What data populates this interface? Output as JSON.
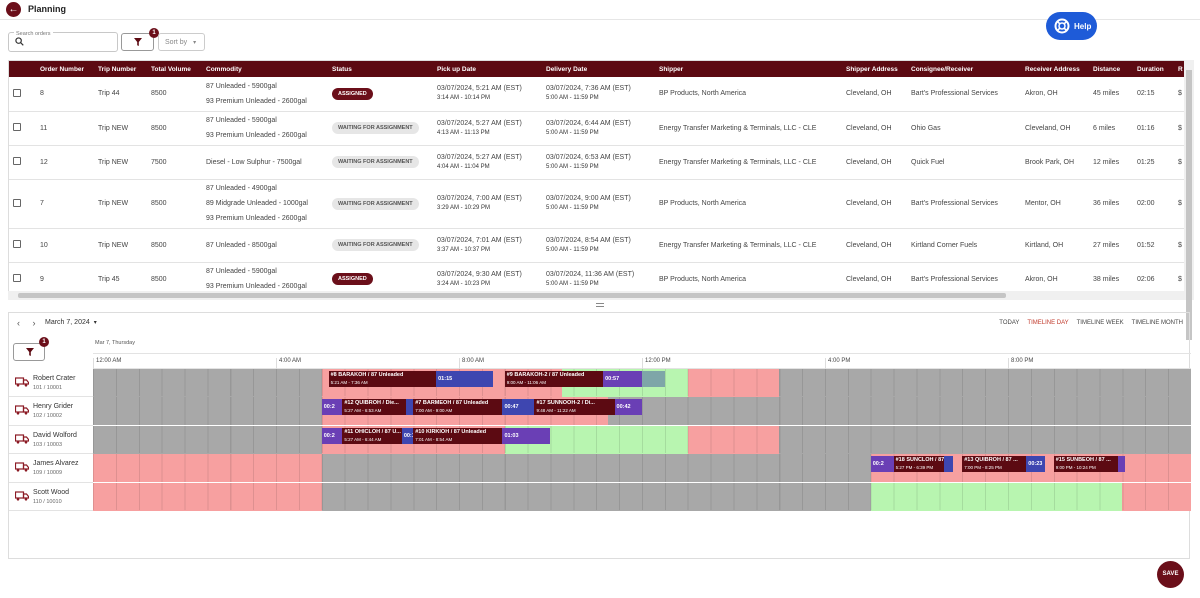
{
  "header": {
    "title": "Planning"
  },
  "toolbar": {
    "search_label": "Search orders",
    "search_value": "",
    "filter_badge": "1",
    "sort_label": "Sort by"
  },
  "help": {
    "label": "Help"
  },
  "orders_table": {
    "columns": [
      "Order Number",
      "Trip Number",
      "Total Volume",
      "Commodity",
      "Status",
      "Pick up Date",
      "Delivery Date",
      "Shipper",
      "Shipper Address",
      "Consignee/Receiver",
      "Receiver Address",
      "Distance",
      "Duration",
      "R"
    ],
    "rows": [
      {
        "order": "8",
        "trip": "Trip 44",
        "volume": "8500",
        "commodity": [
          "87 Unleaded - 5900gal",
          "93 Premium Unleaded - 2600gal"
        ],
        "status": "ASSIGNED",
        "pickup": "03/07/2024, 5:21 AM (EST)",
        "pickup_window": "3:14 AM - 10:14 PM",
        "delivery": "03/07/2024, 7:36 AM (EST)",
        "delivery_window": "5:00 AM - 11:59 PM",
        "shipper": "BP Products, North America",
        "shipper_addr": "Cleveland, OH",
        "consignee": "Bart's Professional Services",
        "receiver_addr": "Akron, OH",
        "distance": "45 miles",
        "duration": "02:15",
        "r": "$"
      },
      {
        "order": "11",
        "trip": "Trip NEW",
        "volume": "8500",
        "commodity": [
          "87 Unleaded - 5900gal",
          "93 Premium Unleaded - 2600gal"
        ],
        "status": "WAITING FOR ASSIGNMENT",
        "pickup": "03/07/2024, 5:27 AM (EST)",
        "pickup_window": "4:13 AM - 11:13 PM",
        "delivery": "03/07/2024, 6:44 AM (EST)",
        "delivery_window": "5:00 AM - 11:59 PM",
        "shipper": "Energy Transfer Marketing & Terminals, LLC - CLE",
        "shipper_addr": "Cleveland, OH",
        "consignee": "Ohio Gas",
        "receiver_addr": "Cleveland, OH",
        "distance": "6 miles",
        "duration": "01:16",
        "r": "$"
      },
      {
        "order": "12",
        "trip": "Trip NEW",
        "volume": "7500",
        "commodity": [
          "Diesel - Low Sulphur - 7500gal"
        ],
        "status": "WAITING FOR ASSIGNMENT",
        "pickup": "03/07/2024, 5:27 AM (EST)",
        "pickup_window": "4:04 AM - 11:04 PM",
        "delivery": "03/07/2024, 6:53 AM (EST)",
        "delivery_window": "5:00 AM - 11:59 PM",
        "shipper": "Energy Transfer Marketing & Terminals, LLC - CLE",
        "shipper_addr": "Cleveland, OH",
        "consignee": "Quick Fuel",
        "receiver_addr": "Brook Park, OH",
        "distance": "12 miles",
        "duration": "01:25",
        "r": "$"
      },
      {
        "order": "7",
        "trip": "Trip NEW",
        "volume": "8500",
        "commodity": [
          "87 Unleaded - 4900gal",
          "89 Midgrade Unleaded - 1000gal",
          "93 Premium Unleaded - 2600gal"
        ],
        "status": "WAITING FOR ASSIGNMENT",
        "pickup": "03/07/2024, 7:00 AM (EST)",
        "pickup_window": "3:29 AM - 10:29 PM",
        "delivery": "03/07/2024, 9:00 AM (EST)",
        "delivery_window": "5:00 AM - 11:59 PM",
        "shipper": "BP Products, North America",
        "shipper_addr": "Cleveland, OH",
        "consignee": "Bart's Professional Services",
        "receiver_addr": "Mentor, OH",
        "distance": "36 miles",
        "duration": "02:00",
        "r": "$"
      },
      {
        "order": "10",
        "trip": "Trip NEW",
        "volume": "8500",
        "commodity": [
          "87 Unleaded - 8500gal"
        ],
        "status": "WAITING FOR ASSIGNMENT",
        "pickup": "03/07/2024, 7:01 AM (EST)",
        "pickup_window": "3:37 AM - 10:37 PM",
        "delivery": "03/07/2024, 8:54 AM (EST)",
        "delivery_window": "5:00 AM - 11:59 PM",
        "shipper": "Energy Transfer Marketing & Terminals, LLC - CLE",
        "shipper_addr": "Cleveland, OH",
        "consignee": "Kirtland Corner Fuels",
        "receiver_addr": "Kirtland, OH",
        "distance": "27 miles",
        "duration": "01:52",
        "r": "$"
      },
      {
        "order": "9",
        "trip": "Trip 45",
        "volume": "8500",
        "commodity": [
          "87 Unleaded - 5900gal",
          "93 Premium Unleaded - 2600gal"
        ],
        "status": "ASSIGNED",
        "pickup": "03/07/2024, 9:30 AM (EST)",
        "pickup_window": "3:24 AM - 10:23 PM",
        "delivery": "03/07/2024, 11:36 AM (EST)",
        "delivery_window": "5:00 AM - 11:59 PM",
        "shipper": "BP Products, North America",
        "shipper_addr": "Cleveland, OH",
        "consignee": "Bart's Professional Services",
        "receiver_addr": "Akron, OH",
        "distance": "38 miles",
        "duration": "02:06",
        "r": "$"
      }
    ]
  },
  "scheduler": {
    "date": "March 7, 2024",
    "day_label": "Mar 7, Thursday",
    "filter_badge": "1",
    "views": [
      "TODAY",
      "TIMELINE DAY",
      "TIMELINE WEEK",
      "TIMELINE MONTH"
    ],
    "active_view": "TIMELINE DAY",
    "hour_labels": [
      "12:00 AM",
      "4:00 AM",
      "8:00 AM",
      "12:00 PM",
      "4:00 PM",
      "8:00 PM"
    ],
    "drivers": [
      {
        "name": "Robert Crater",
        "id": "101 / 10001",
        "segments": [
          [
            0,
            10,
            "gray"
          ],
          [
            10,
            20.5,
            "red"
          ],
          [
            20.5,
            26,
            "green"
          ],
          [
            26,
            30,
            "red"
          ],
          [
            30,
            48,
            "gray"
          ]
        ],
        "events": [
          {
            "start": 10.3,
            "end": 15.0,
            "kind": "dark",
            "title": "#8 BARAKOH / 87 Unleaded",
            "sub": "5:21 AM - 7:36 AM"
          },
          {
            "start": 15.0,
            "end": 17.5,
            "kind": "trav2",
            "title": "01:15"
          },
          {
            "start": 18.0,
            "end": 22.3,
            "kind": "dark",
            "title": "#9 BARAKOH-2 / 87 Unleaded",
            "sub": "9:00 AM - 11:06 AM"
          },
          {
            "start": 22.3,
            "end": 24.0,
            "kind": "trav",
            "title": "00:57"
          },
          {
            "start": 24.0,
            "end": 25.0,
            "kind": "gray",
            "title": ""
          }
        ]
      },
      {
        "name": "Henry Grider",
        "id": "102 / 10002",
        "segments": [
          [
            0,
            10,
            "gray"
          ],
          [
            10,
            22.5,
            "red"
          ],
          [
            22.5,
            48,
            "gray"
          ]
        ],
        "events": [
          {
            "start": 10.0,
            "end": 10.9,
            "kind": "trav",
            "title": "00:2"
          },
          {
            "start": 10.9,
            "end": 13.7,
            "kind": "dark",
            "title": "#12 QUIBROH / Die...",
            "sub": "5:27 AM - 6:53 AM"
          },
          {
            "start": 13.7,
            "end": 14.0,
            "kind": "trav2",
            "title": ""
          },
          {
            "start": 14.0,
            "end": 17.9,
            "kind": "dark",
            "title": "#7 BARMEOH / 87 Unleaded",
            "sub": "7:00 AM - 9:00 AM"
          },
          {
            "start": 17.9,
            "end": 19.3,
            "kind": "trav2",
            "title": "00:47"
          },
          {
            "start": 19.3,
            "end": 22.8,
            "kind": "dark",
            "title": "#17 SUNNOOH-2 / Di...",
            "sub": "9:48 AM - 11:22 AM"
          },
          {
            "start": 22.8,
            "end": 24.0,
            "kind": "trav",
            "title": "00:42"
          }
        ]
      },
      {
        "name": "David Wolford",
        "id": "103 / 10003",
        "segments": [
          [
            0,
            10,
            "gray"
          ],
          [
            10,
            18,
            "red"
          ],
          [
            18,
            26,
            "green"
          ],
          [
            26,
            30,
            "red"
          ],
          [
            30,
            48,
            "gray"
          ]
        ],
        "events": [
          {
            "start": 10.0,
            "end": 10.9,
            "kind": "trav",
            "title": "00:2"
          },
          {
            "start": 10.9,
            "end": 13.5,
            "kind": "dark",
            "title": "#11 OHICLOH / 87 U...",
            "sub": "5:27 AM - 6:44 AM"
          },
          {
            "start": 13.5,
            "end": 14.0,
            "kind": "trav2",
            "title": "00:1"
          },
          {
            "start": 14.0,
            "end": 17.9,
            "kind": "dark",
            "title": "#10 KIRKIOH / 87 Unleaded",
            "sub": "7:01 AM - 8:54 AM"
          },
          {
            "start": 17.9,
            "end": 20.0,
            "kind": "trav",
            "title": "01:03"
          }
        ]
      },
      {
        "name": "James Alvarez",
        "id": "109 / 10009",
        "segments": [
          [
            0,
            10,
            "red"
          ],
          [
            10,
            34,
            "gray"
          ],
          [
            34,
            48,
            "red"
          ]
        ],
        "events": [
          {
            "start": 34.0,
            "end": 35.0,
            "kind": "trav",
            "title": "00:2"
          },
          {
            "start": 35.0,
            "end": 37.2,
            "kind": "dark",
            "title": "#18 SUNCLOH / 87 ...",
            "sub": "5:27 PM - 6:39 PM"
          },
          {
            "start": 37.2,
            "end": 37.6,
            "kind": "trav2",
            "title": ""
          },
          {
            "start": 38.0,
            "end": 40.8,
            "kind": "dark",
            "title": "#13 QUIBROH / 87 ...",
            "sub": "7:00 PM - 8:25 PM"
          },
          {
            "start": 40.8,
            "end": 41.6,
            "kind": "trav2",
            "title": "00:23"
          },
          {
            "start": 42.0,
            "end": 44.8,
            "kind": "dark",
            "title": "#15 SUNBEOH / 87 ...",
            "sub": "9:00 PM - 10:24 PM"
          },
          {
            "start": 44.8,
            "end": 45.1,
            "kind": "trav",
            "title": ""
          }
        ]
      },
      {
        "name": "Scott Wood",
        "id": "110 / 10010",
        "segments": [
          [
            0,
            10,
            "red"
          ],
          [
            10,
            34,
            "gray"
          ],
          [
            34,
            45,
            "green"
          ],
          [
            45,
            48,
            "red"
          ]
        ],
        "events": []
      }
    ]
  },
  "save": {
    "label": "SAVE"
  },
  "colors": {
    "brand": "#6b0f1a",
    "help": "#1e5bd8",
    "unavailable": "#f7a0a0",
    "available": "#b8f5b0",
    "offduty": "#a8a8a8"
  }
}
